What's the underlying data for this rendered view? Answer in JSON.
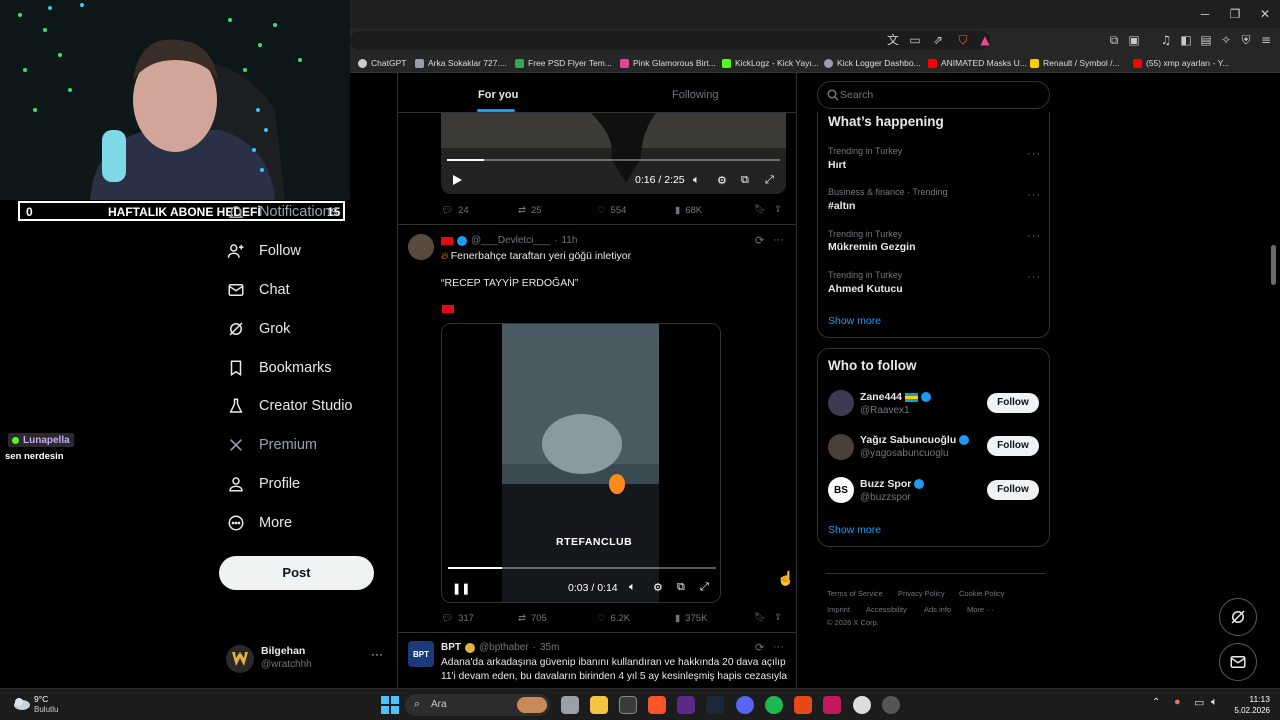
{
  "browser": {
    "bookmarks": [
      {
        "label": "ChatGPT",
        "icon": "chatgpt-icon",
        "color": "#cccccc"
      },
      {
        "label": "Arka Sokaklar 727....",
        "icon": "bookmark-favicon",
        "color": "#9aa0a6"
      },
      {
        "label": "Free PSD Flyer Tem...",
        "icon": "bookmark-favicon",
        "color": "#34a853"
      },
      {
        "label": "Pink Glamorous Birt...",
        "icon": "bookmark-favicon",
        "color": "#e84393"
      },
      {
        "label": "KickLogz - Kick Yayı...",
        "icon": "bookmark-favicon",
        "color": "#53fc18"
      },
      {
        "label": "Kick Logger Dashbo...",
        "icon": "bookmark-favicon",
        "color": "#9aa0a6"
      },
      {
        "label": "ANIMATED Masks U...",
        "icon": "youtube-icon",
        "color": "#ff0000"
      },
      {
        "label": "Renault / Symbol /...",
        "icon": "bookmark-favicon",
        "color": "#f5d000"
      },
      {
        "label": "(55) xmp ayarları - Y...",
        "icon": "youtube-icon",
        "color": "#ff0000"
      }
    ]
  },
  "stream": {
    "goal_current": "0",
    "goal_label": "HAFTALIK ABONE HEDEFİ",
    "goal_target": "15",
    "chat_user": "Lunapella",
    "chat_message": "sen nerdesin"
  },
  "nav": {
    "notifications": "Notifications",
    "follow": "Follow",
    "chat": "Chat",
    "grok": "Grok",
    "bookmarks": "Bookmarks",
    "creator_studio": "Creator Studio",
    "premium": "Premium",
    "profile": "Profile",
    "more": "More",
    "post": "Post",
    "account_name": "Bilgehan",
    "account_handle": "@wratchhh"
  },
  "feed": {
    "tabs": {
      "for_you": "For you",
      "following": "Following"
    },
    "video1": {
      "time": "0:16 / 2:25",
      "progress": 0.11
    },
    "post1_stats": {
      "replies": "24",
      "reposts": "25",
      "likes": "554",
      "views": "68K"
    },
    "post2": {
      "name": "",
      "handle": "@___Devletci___",
      "time": "11h",
      "line1": "Fenerbahçe taraftarı yeri göğü inletiyor",
      "line2": "“RECEP TAYYİP ERDOĞAN”",
      "video_caption": "RTEFANCLUB",
      "video_time": "0:03 / 0:14",
      "progress": 0.2,
      "stats": {
        "replies": "317",
        "reposts": "705",
        "likes": "6.2K",
        "views": "375K"
      }
    },
    "post3": {
      "name": "BPT",
      "handle": "@bpthaber",
      "time": "35m",
      "text1": "Adana'da arkadaşına güvenip ibanını kullandıran ve hakkında 20 dava açılıp",
      "text2": "11'i devam eden, bu davaların birinden 4 yıl 5 ay kesinleşmiş hapis cezasıyla",
      "avatar_text": "BPT"
    }
  },
  "sidebar": {
    "search_placeholder": "Search",
    "happening_title": "What’s happening",
    "trends": [
      {
        "meta": "Trending in Turkey",
        "name": "Hırt"
      },
      {
        "meta": "Business & finance · Trending",
        "name": "#altın"
      },
      {
        "meta": "Trending in Turkey",
        "name": "Mükremin Gezgin"
      },
      {
        "meta": "Trending in Turkey",
        "name": "Ahmed Kutucu"
      }
    ],
    "show_more": "Show more",
    "who_to_follow_title": "Who to follow",
    "suggestions": [
      {
        "name": "Zane444",
        "handle": "@Raavex1",
        "button": "Follow"
      },
      {
        "name": "Yağız Sabuncuoğlu",
        "handle": "@yagosabuncuoglu",
        "button": "Follow"
      },
      {
        "name": "Buzz Spor",
        "handle": "@buzzspor",
        "button": "Follow",
        "avatar_text": "BS"
      }
    ],
    "show_more_2": "Show more",
    "footer": {
      "terms": "Terms of Service",
      "privacy": "Privacy Policy",
      "cookie": "Cookie Policy",
      "imprint": "Imprint",
      "accessibility": "Accessibility",
      "ads": "Ads info",
      "more": "More ···",
      "copyright": "© 2026 X Corp."
    }
  },
  "taskbar": {
    "temp": "9°C",
    "weather": "Bulutlu",
    "search_placeholder": "Ara",
    "time": "11:13",
    "date": "5.02.2026"
  }
}
